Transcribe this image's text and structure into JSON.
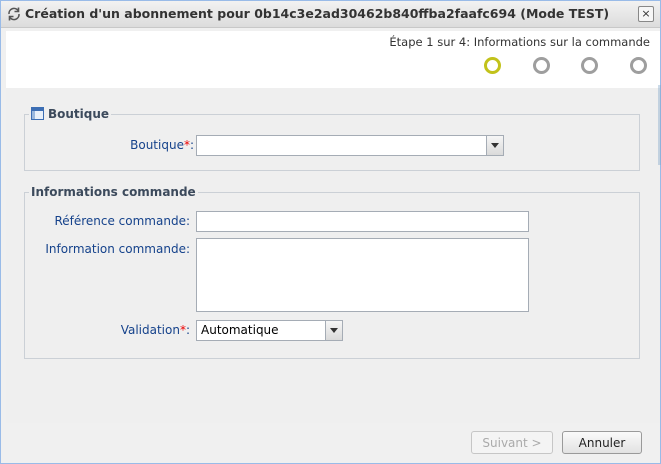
{
  "window": {
    "title": "Création d'un abonnement pour 0b14c3e2ad30462b840ffba2faafc694 (Mode TEST)",
    "close_label": "×"
  },
  "wizard": {
    "step_text": "Étape 1 sur 4: Informations sur la commande",
    "current_step": 1,
    "total_steps": 4
  },
  "boutique_section": {
    "legend": "Boutique",
    "boutique_label": "Boutique",
    "boutique_value": "",
    "required_mark": "*",
    "colon": ":"
  },
  "order_section": {
    "legend": "Informations commande",
    "reference_label": "Référence commande:",
    "reference_value": "",
    "info_label": "Information commande:",
    "info_value": "",
    "validation_label": "Validation",
    "validation_value": "Automatique",
    "required_mark": "*",
    "colon": ":"
  },
  "footer": {
    "next_label": "Suivant >",
    "cancel_label": "Annuler"
  },
  "colors": {
    "label": "#15428b",
    "active_step": "#c2c21b",
    "inactive_step": "#9e9e9e",
    "required": "#e00000"
  }
}
